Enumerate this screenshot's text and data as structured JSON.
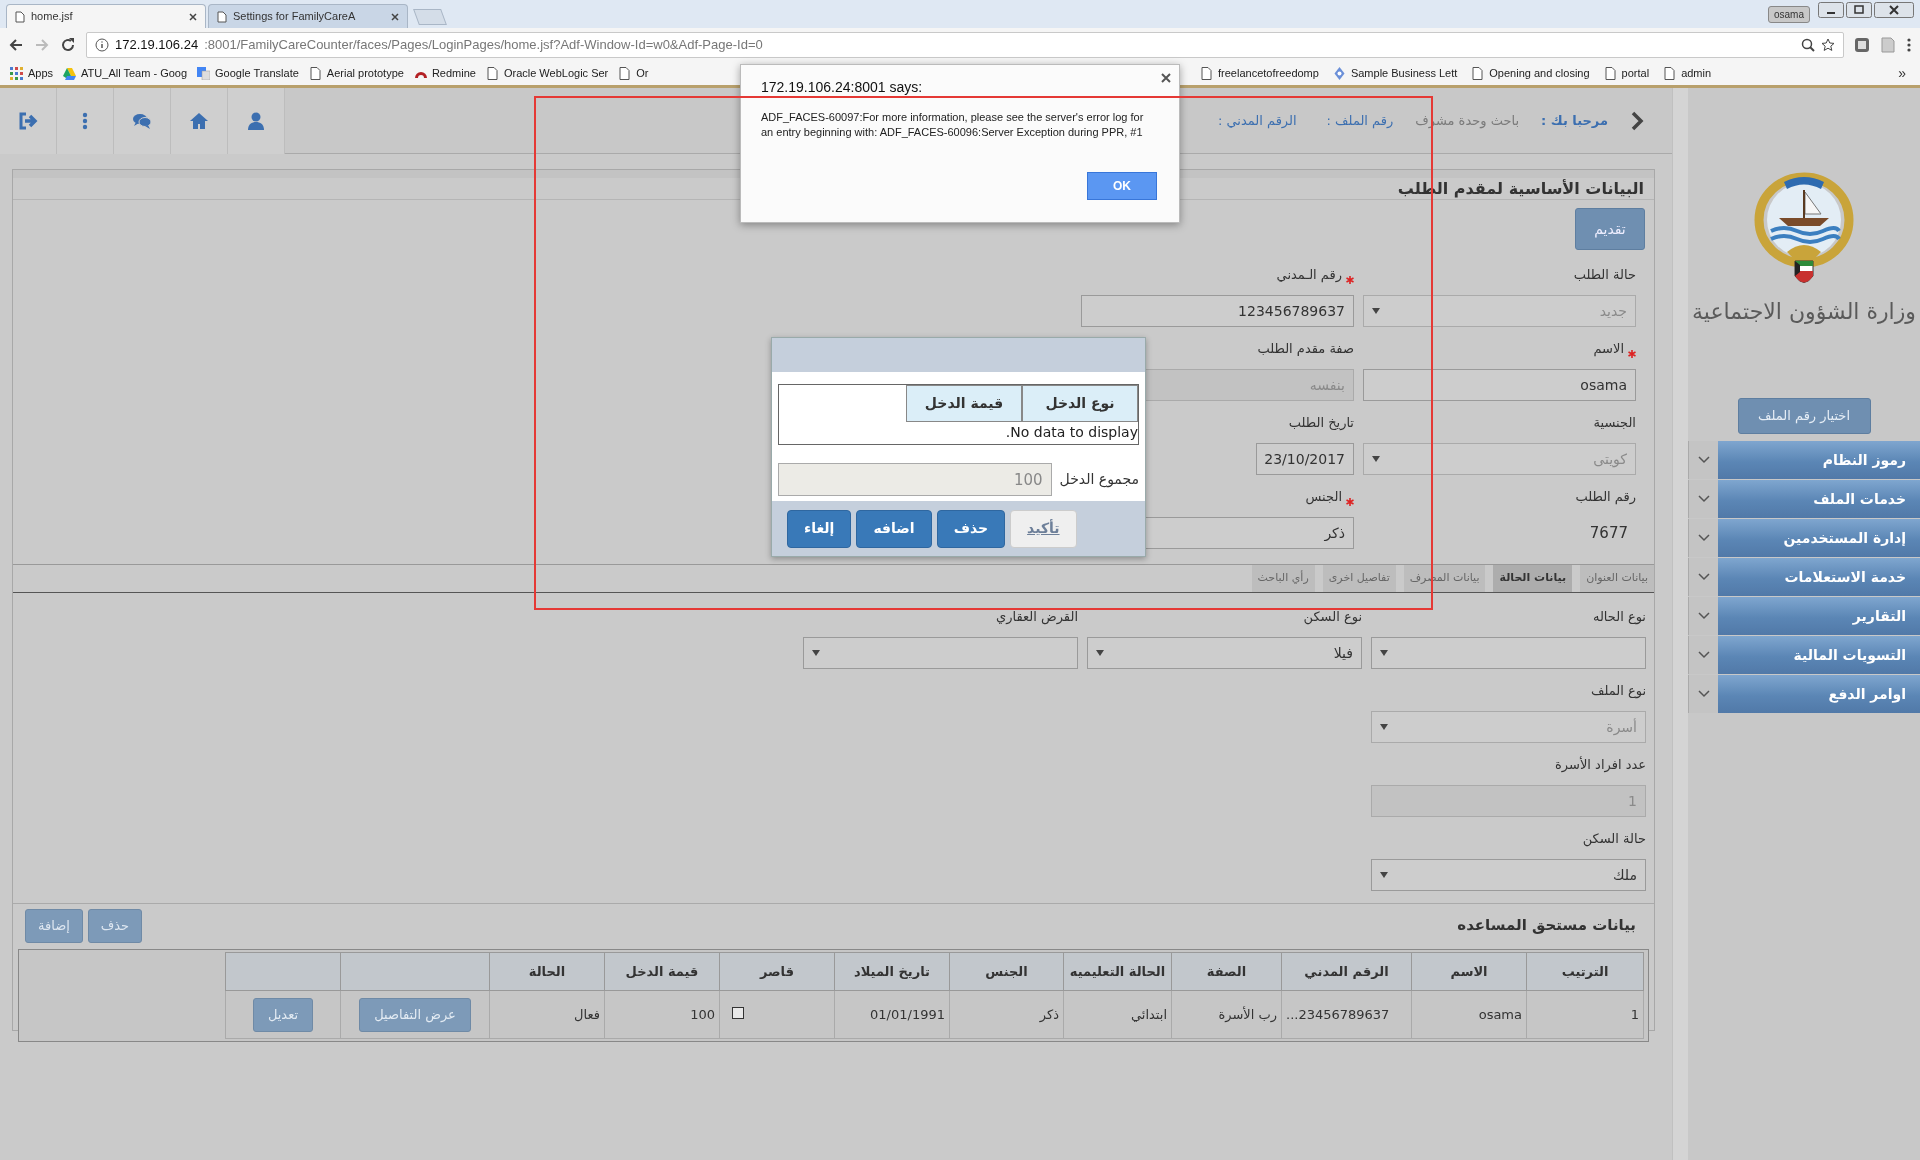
{
  "browser": {
    "tabs": [
      {
        "title": "Settings for FamilyCareA",
        "selected": false
      },
      {
        "title": "home.jsf",
        "selected": true
      }
    ],
    "user": "osama",
    "address": {
      "host": "172.19.106.24",
      "path": ":8001/FamilyCareCounter/faces/Pages/LoginPages/home.jsf?Adf-Window-Id=w0&Adf-Page-Id=0"
    },
    "bookmarks": [
      {
        "label": "admin",
        "kind": "page"
      },
      {
        "label": "portal",
        "kind": "page"
      },
      {
        "label": "Opening and closing",
        "kind": "page"
      },
      {
        "label": "Sample Business Lett",
        "kind": "web"
      },
      {
        "label": "freelancetofreedomp",
        "kind": "page"
      },
      {
        "label": "Or",
        "kind": "page"
      },
      {
        "label": "Oracle WebLogic Ser",
        "kind": "page"
      },
      {
        "label": "Redmine",
        "kind": "redmine"
      },
      {
        "label": "Aerial prototype",
        "kind": "page"
      },
      {
        "label": "Google Translate",
        "kind": "translate"
      },
      {
        "label": "ATU_All Team - Goog",
        "kind": "drive"
      },
      {
        "label": "Apps",
        "kind": "apps"
      }
    ],
    "overflow": "»"
  },
  "header": {
    "welcome": "مرحبا بك :",
    "role": "باحث وحدة مشرف",
    "file_label": "رقم الملف :",
    "civil_label": "الرقم المدني :"
  },
  "applicant": {
    "title": "البيانات الأساسية لمقدم الطلب",
    "submit_button": "تقديم",
    "rows": [
      [
        {
          "label": "حالة الطلب",
          "required": false,
          "kind": "select",
          "value": "جديد",
          "disabled": true
        },
        {
          "label": "رقم الـمدني",
          "required": true,
          "kind": "text",
          "value": "123456789637",
          "disabled": false
        }
      ],
      [
        {
          "label": "الاسم",
          "required": true,
          "kind": "text",
          "value": "osama",
          "disabled": false
        },
        {
          "label": "صفة مقدم الطلب",
          "required": false,
          "kind": "text",
          "value": "بنفسه",
          "disabled": true
        }
      ],
      [
        {
          "label": "الجنسية",
          "required": false,
          "kind": "select",
          "value": "كويتى",
          "disabled": true
        },
        {
          "label": "تاريخ الطلب",
          "required": false,
          "kind": "date",
          "value": "23/10/2017",
          "disabled": false
        }
      ],
      [
        {
          "label": "رقم الطلب",
          "required": false,
          "kind": "static",
          "value": "7677"
        },
        {
          "label": "الجنس",
          "required": true,
          "kind": "text",
          "value": "ذكر",
          "disabled": false
        }
      ]
    ]
  },
  "detail_tabs": [
    {
      "label": "بيانات العنوان",
      "selected": false
    },
    {
      "label": "بيانات الحالة",
      "selected": true
    },
    {
      "label": "بيانات المصرف",
      "selected": false
    },
    {
      "label": "تفاصيل اخرى",
      "selected": false
    },
    {
      "label": "رأي الباحث",
      "selected": false
    }
  ],
  "case_fields": [
    [
      {
        "label": "نوع الحاله",
        "kind": "select",
        "disabled": false
      },
      {
        "label": "نوع السكن",
        "kind": "select",
        "value": "فيلا",
        "disabled": false
      },
      {
        "label": "القرض العقاري",
        "kind": "select",
        "disabled": false
      }
    ],
    [
      {
        "label": "نوع الملف",
        "kind": "select",
        "value": "أسرة",
        "disabled": true
      }
    ],
    [
      {
        "label": "عدد افراد الأسرة",
        "kind": "text",
        "value": "1",
        "disabled": true
      }
    ],
    [
      {
        "label": "حالة السكن",
        "kind": "select",
        "value": "ملك",
        "disabled": false
      }
    ]
  ],
  "beneficiaries": {
    "title": "بيانات مستحق المساعده",
    "buttons": [
      "حذف",
      "إضافة"
    ],
    "columns": [
      "الترتيب",
      "الاسم",
      "الرقم المدني",
      "الصفة",
      "الحالة التعليميه",
      "الجنس",
      "تاريخ الميلاد",
      "قاصر",
      "قيمة الدخل",
      "الحالة"
    ],
    "rows": [
      {
        "cells": [
          "1",
          "osama",
          "...23456789637",
          "رب الأسرة",
          "ابتدائي",
          "ذكر",
          "01/01/1991",
          {
            "kind": "checkbox",
            "checked": false
          },
          "100",
          "فعال"
        ],
        "actions": [
          "عرض التفاصيل",
          "تعديل"
        ]
      }
    ]
  },
  "sidebar": {
    "title": "وزارة الشؤون الاجتماعية",
    "pick_file_button": "اختيار رقم الملف",
    "menu": [
      {
        "label": "رموز النظام",
        "expanded": false
      },
      {
        "label": "خدمات الملف",
        "expanded": false
      },
      {
        "label": "إدارة المستخدمين",
        "expanded": false
      },
      {
        "label": "خدمة الاستعلامات",
        "expanded": false
      },
      {
        "label": "التقارير",
        "expanded": false
      },
      {
        "label": "التسويات المالية",
        "expanded": false
      },
      {
        "label": "اوامر الدفع",
        "expanded": false
      }
    ]
  },
  "income_dialog": {
    "columns": [
      "نوع الدخل",
      "قيمة الدخل"
    ],
    "empty_message": "No data to display.",
    "total_label": "مجموع الدخل",
    "total_value": "100",
    "buttons": [
      {
        "label": "تأكيد",
        "disabled": true
      },
      {
        "label": "حذف",
        "disabled": false
      },
      {
        "label": "اضافه",
        "disabled": false
      },
      {
        "label": "إلغاء",
        "disabled": false
      }
    ]
  },
  "alert": {
    "title": "172.19.106.24:8001 says:",
    "message": "ADF_FACES-60097:For more information, please see the server's error log for an entry beginning with: ADF_FACES-60096:Server Exception during PPR, #1",
    "button": "OK"
  }
}
